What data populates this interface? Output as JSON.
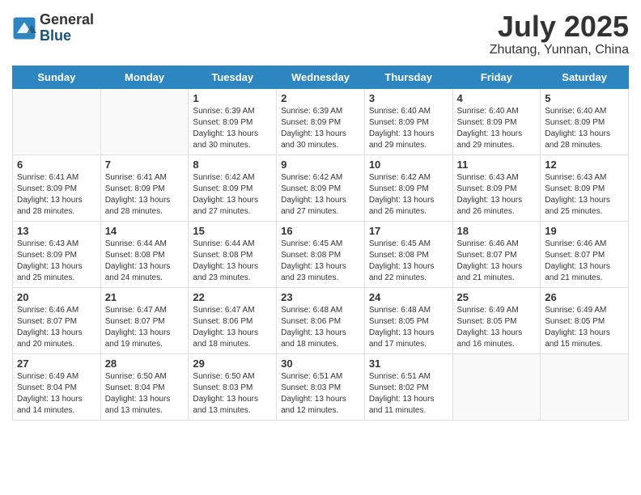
{
  "header": {
    "logo_general": "General",
    "logo_blue": "Blue",
    "month_year": "July 2025",
    "location": "Zhutang, Yunnan, China"
  },
  "weekdays": [
    "Sunday",
    "Monday",
    "Tuesday",
    "Wednesday",
    "Thursday",
    "Friday",
    "Saturday"
  ],
  "weeks": [
    [
      {
        "day": "",
        "info": ""
      },
      {
        "day": "",
        "info": ""
      },
      {
        "day": "1",
        "info": "Sunrise: 6:39 AM\nSunset: 8:09 PM\nDaylight: 13 hours\nand 30 minutes."
      },
      {
        "day": "2",
        "info": "Sunrise: 6:39 AM\nSunset: 8:09 PM\nDaylight: 13 hours\nand 30 minutes."
      },
      {
        "day": "3",
        "info": "Sunrise: 6:40 AM\nSunset: 8:09 PM\nDaylight: 13 hours\nand 29 minutes."
      },
      {
        "day": "4",
        "info": "Sunrise: 6:40 AM\nSunset: 8:09 PM\nDaylight: 13 hours\nand 29 minutes."
      },
      {
        "day": "5",
        "info": "Sunrise: 6:40 AM\nSunset: 8:09 PM\nDaylight: 13 hours\nand 28 minutes."
      }
    ],
    [
      {
        "day": "6",
        "info": "Sunrise: 6:41 AM\nSunset: 8:09 PM\nDaylight: 13 hours\nand 28 minutes."
      },
      {
        "day": "7",
        "info": "Sunrise: 6:41 AM\nSunset: 8:09 PM\nDaylight: 13 hours\nand 28 minutes."
      },
      {
        "day": "8",
        "info": "Sunrise: 6:42 AM\nSunset: 8:09 PM\nDaylight: 13 hours\nand 27 minutes."
      },
      {
        "day": "9",
        "info": "Sunrise: 6:42 AM\nSunset: 8:09 PM\nDaylight: 13 hours\nand 27 minutes."
      },
      {
        "day": "10",
        "info": "Sunrise: 6:42 AM\nSunset: 8:09 PM\nDaylight: 13 hours\nand 26 minutes."
      },
      {
        "day": "11",
        "info": "Sunrise: 6:43 AM\nSunset: 8:09 PM\nDaylight: 13 hours\nand 26 minutes."
      },
      {
        "day": "12",
        "info": "Sunrise: 6:43 AM\nSunset: 8:09 PM\nDaylight: 13 hours\nand 25 minutes."
      }
    ],
    [
      {
        "day": "13",
        "info": "Sunrise: 6:43 AM\nSunset: 8:09 PM\nDaylight: 13 hours\nand 25 minutes."
      },
      {
        "day": "14",
        "info": "Sunrise: 6:44 AM\nSunset: 8:08 PM\nDaylight: 13 hours\nand 24 minutes."
      },
      {
        "day": "15",
        "info": "Sunrise: 6:44 AM\nSunset: 8:08 PM\nDaylight: 13 hours\nand 23 minutes."
      },
      {
        "day": "16",
        "info": "Sunrise: 6:45 AM\nSunset: 8:08 PM\nDaylight: 13 hours\nand 23 minutes."
      },
      {
        "day": "17",
        "info": "Sunrise: 6:45 AM\nSunset: 8:08 PM\nDaylight: 13 hours\nand 22 minutes."
      },
      {
        "day": "18",
        "info": "Sunrise: 6:46 AM\nSunset: 8:07 PM\nDaylight: 13 hours\nand 21 minutes."
      },
      {
        "day": "19",
        "info": "Sunrise: 6:46 AM\nSunset: 8:07 PM\nDaylight: 13 hours\nand 21 minutes."
      }
    ],
    [
      {
        "day": "20",
        "info": "Sunrise: 6:46 AM\nSunset: 8:07 PM\nDaylight: 13 hours\nand 20 minutes."
      },
      {
        "day": "21",
        "info": "Sunrise: 6:47 AM\nSunset: 8:07 PM\nDaylight: 13 hours\nand 19 minutes."
      },
      {
        "day": "22",
        "info": "Sunrise: 6:47 AM\nSunset: 8:06 PM\nDaylight: 13 hours\nand 18 minutes."
      },
      {
        "day": "23",
        "info": "Sunrise: 6:48 AM\nSunset: 8:06 PM\nDaylight: 13 hours\nand 18 minutes."
      },
      {
        "day": "24",
        "info": "Sunrise: 6:48 AM\nSunset: 8:05 PM\nDaylight: 13 hours\nand 17 minutes."
      },
      {
        "day": "25",
        "info": "Sunrise: 6:49 AM\nSunset: 8:05 PM\nDaylight: 13 hours\nand 16 minutes."
      },
      {
        "day": "26",
        "info": "Sunrise: 6:49 AM\nSunset: 8:05 PM\nDaylight: 13 hours\nand 15 minutes."
      }
    ],
    [
      {
        "day": "27",
        "info": "Sunrise: 6:49 AM\nSunset: 8:04 PM\nDaylight: 13 hours\nand 14 minutes."
      },
      {
        "day": "28",
        "info": "Sunrise: 6:50 AM\nSunset: 8:04 PM\nDaylight: 13 hours\nand 13 minutes."
      },
      {
        "day": "29",
        "info": "Sunrise: 6:50 AM\nSunset: 8:03 PM\nDaylight: 13 hours\nand 13 minutes."
      },
      {
        "day": "30",
        "info": "Sunrise: 6:51 AM\nSunset: 8:03 PM\nDaylight: 13 hours\nand 12 minutes."
      },
      {
        "day": "31",
        "info": "Sunrise: 6:51 AM\nSunset: 8:02 PM\nDaylight: 13 hours\nand 11 minutes."
      },
      {
        "day": "",
        "info": ""
      },
      {
        "day": "",
        "info": ""
      }
    ]
  ]
}
